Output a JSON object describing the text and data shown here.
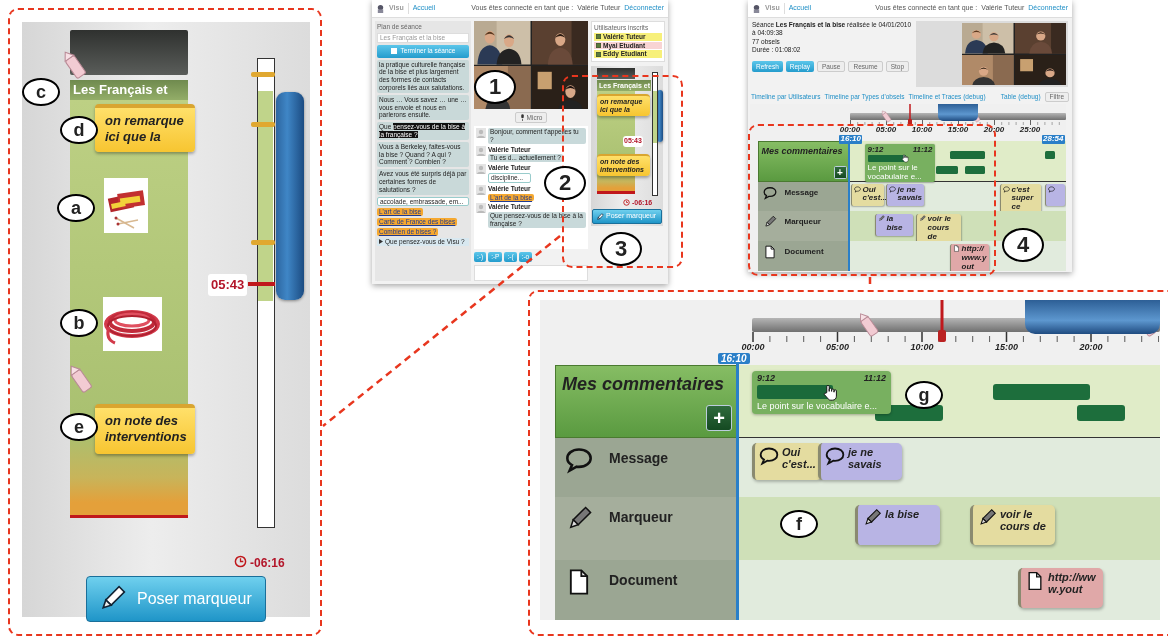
{
  "callouts": [
    {
      "label": "c"
    },
    {
      "label": "d"
    },
    {
      "label": "a"
    },
    {
      "label": "b"
    },
    {
      "label": "e"
    },
    {
      "label": "1"
    },
    {
      "label": "2"
    },
    {
      "label": "3"
    },
    {
      "label": "4"
    },
    {
      "label": "g"
    },
    {
      "label": "f"
    }
  ],
  "marker_panel": {
    "title": "Les Français et",
    "markers": [
      {
        "kind": "note",
        "text": "on remarque ici que la"
      },
      {
        "kind": "picture"
      },
      {
        "kind": "picture"
      },
      {
        "kind": "note",
        "text": "on note des interventions"
      }
    ],
    "time": "05:43",
    "remaining": "-06:16",
    "button": "Poser marqueur"
  },
  "session_screen": {
    "header": {
      "logo": "Visu",
      "home": "Accueil",
      "connected": "Vous êtes connecté en tant que :",
      "user": "Valérie Tuteur",
      "logout": "Déconnecter"
    },
    "plan": {
      "title": "Plan de séance",
      "select": "Les Français et la bise",
      "end_button": "Terminer la séance",
      "items": [
        {
          "kind": "text",
          "text": "la pratique culturelle française de la bise et plus largement des formes de contacts corporels liés aux salutations."
        },
        {
          "kind": "text",
          "text": "Nous … Vous savez … une … vous envoie et nous en parlerons ensuite."
        },
        {
          "kind": "text",
          "text": "Que",
          "highlight": "pensez-vous de la bise à la française ?"
        },
        {
          "kind": "text",
          "text": "Vous à Berkeley, faites-vous la bise ? Quand ? A qui ? Comment ? Combien ?"
        },
        {
          "kind": "text",
          "text": "Avez vous été surpris déjà par certaines formes de salutations ?"
        },
        {
          "kind": "answer",
          "text": "accolade, embrassade, em..."
        },
        {
          "kind": "link",
          "text": "L'art de la bise"
        },
        {
          "kind": "link",
          "text": "Carte de France des bises"
        },
        {
          "kind": "link",
          "text": "Combien de bises ?"
        },
        {
          "kind": "question",
          "text": "Que pensez-vous de Visu ?"
        }
      ]
    },
    "mic_button": "Micro",
    "chat": {
      "messages": [
        {
          "kind": "text",
          "text": "Bonjour, comment t'appelles tu ?"
        },
        {
          "kind": "text",
          "author": "Valérie Tuteur",
          "text": "Tu es d... actuellement ?"
        },
        {
          "kind": "answer",
          "author": "Valérie Tuteur",
          "text": "discipline..."
        },
        {
          "kind": "link",
          "author": "Valérie Tuteur",
          "text": "L'art de la bise"
        },
        {
          "kind": "text",
          "author": "Valérie Tuteur",
          "text": "Que pensez-vous de la bise à la française ?"
        }
      ],
      "emoticons": [
        ":-)",
        ":-P",
        ":-(",
        ":-o"
      ]
    },
    "users": {
      "title": "Utilisateurs inscrits",
      "items": [
        {
          "name": "Valérie Tuteur",
          "color": "#f7f07a"
        },
        {
          "name": "Myai Etudiant",
          "color": "#f8d4d4"
        },
        {
          "name": "Eddy Etudiant",
          "color": "#f7f07a"
        }
      ]
    },
    "marker_panel": {
      "title": "Les Français et",
      "markers": [
        {
          "kind": "note",
          "text": "on remarque ici que la"
        },
        {
          "kind": "note",
          "text": "on note des interventions"
        }
      ],
      "time": "05:43",
      "remaining": "-06:16",
      "button": "Poser marqueur"
    }
  },
  "replay_screen": {
    "header": {
      "logo": "Visu",
      "home": "Accueil",
      "connected": "Vous êtes connecté en tant que :",
      "user": "Valérie Tuteur",
      "logout": "Déconnecter"
    },
    "session": "Séance **Les Français et la bise** réalisée le 04/01/2010 à 04:09:38",
    "obsels": "77 obsels",
    "duration": "Durée : 01:08:02",
    "buttons": [
      {
        "label": "Refresh",
        "enabled": true
      },
      {
        "label": "Replay",
        "enabled": true
      },
      {
        "label": "Pause",
        "enabled": false
      },
      {
        "label": "Resume",
        "enabled": false
      },
      {
        "label": "Stop",
        "enabled": false
      }
    ],
    "links": [
      "Timeline par Utilisateurs",
      "Timeline par Types d'obsels",
      "Timeline et Traces (debug)"
    ],
    "table_link": "Table (debug)",
    "filter_button": "Filtre",
    "timeline": {
      "ticks": [
        "00:00",
        "05:00",
        "10:00",
        "15:00",
        "20:00",
        "25:00"
      ],
      "now": "16:10",
      "end": "28:54",
      "rows": [
        {
          "kind": "comments",
          "label": "Mes commentaires",
          "add_button": "+",
          "items": [
            {
              "expanded": true,
              "start": "9:12",
              "end": "11:12",
              "text": "Le point sur le vocabulaire e..."
            },
            {
              "expanded": false
            },
            {
              "expanded": false
            },
            {
              "expanded": false
            },
            {
              "expanded": false
            }
          ]
        },
        {
          "kind": "message",
          "label": "Message",
          "items": [
            {
              "text": "Oui c'est...",
              "color": "#e4dca0"
            },
            {
              "text": "je ne savais",
              "color": "#b8b4e4"
            },
            {
              "text": "c'est super ce",
              "color": "#e4dca0"
            },
            {
              "color": "#b8b4e4"
            }
          ]
        },
        {
          "kind": "marker",
          "label": "Marqueur",
          "items": [
            {
              "text": "la bise",
              "color": "#b8b4e4"
            },
            {
              "text": "voir le cours de",
              "color": "#e4dca0"
            }
          ]
        },
        {
          "kind": "document",
          "label": "Document",
          "items": [
            {
              "text": "http://www.yout",
              "color": "#e0a8a8"
            }
          ]
        }
      ]
    }
  },
  "zoomed_timeline": {
    "ticks": [
      "00:00",
      "05:00",
      "10:00",
      "15:00",
      "20:00"
    ],
    "now": "16:10",
    "rows": [
      {
        "kind": "comments",
        "label": "Mes commentaires",
        "add_button": "+",
        "items": [
          {
            "expanded": true,
            "start": "9:12",
            "end": "11:12",
            "text": "Le point sur le vocabulaire e..."
          },
          {
            "expanded": false
          },
          {
            "expanded": false
          },
          {
            "expanded": false
          }
        ]
      },
      {
        "kind": "message",
        "label": "Message",
        "items": [
          {
            "text": "Oui c'est...",
            "color": "#e4dca0"
          },
          {
            "text": "je ne savais",
            "color": "#b8b4e4"
          }
        ]
      },
      {
        "kind": "marker",
        "label": "Marqueur",
        "items": [
          {
            "text": "la bise",
            "color": "#b8b4e4"
          },
          {
            "text": "voir le cours de",
            "color": "#e4dca0"
          }
        ]
      },
      {
        "kind": "document",
        "label": "Document",
        "items": [
          {
            "text": "http://www.yout",
            "color": "#e0a8a8"
          }
        ]
      }
    ]
  }
}
